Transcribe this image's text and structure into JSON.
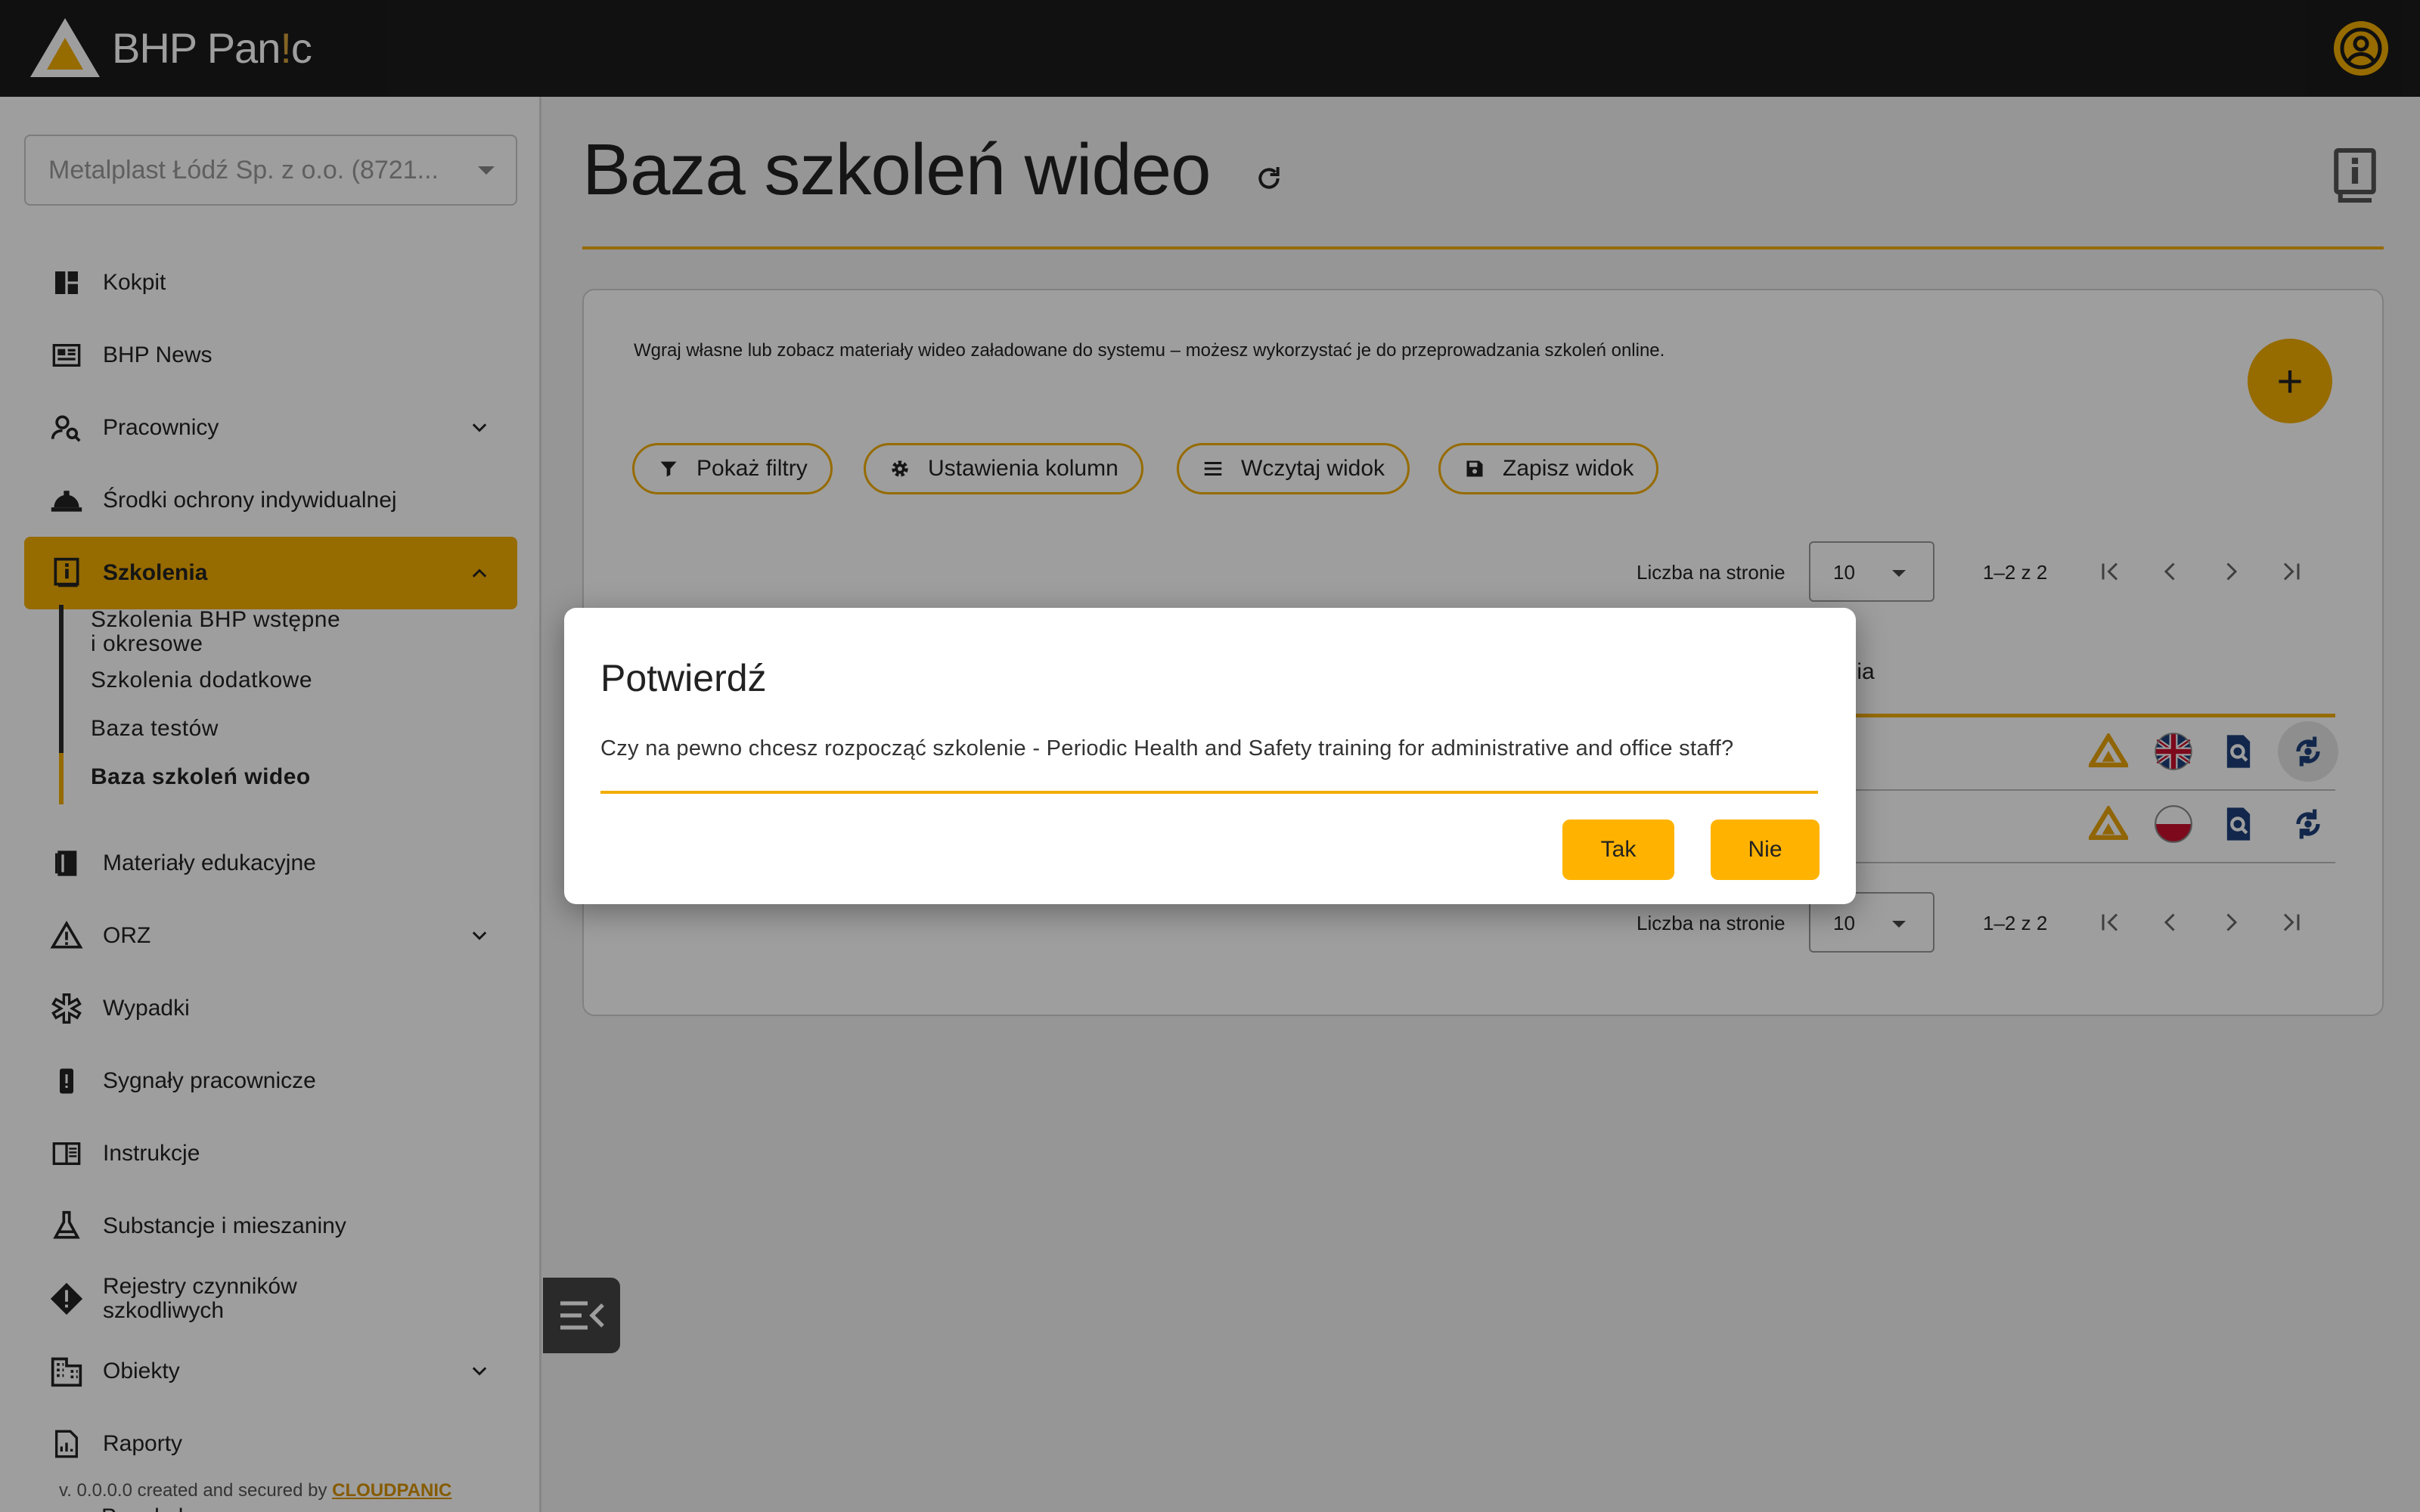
{
  "app": {
    "logo_main": "BHP Pan",
    "logo_accent": "!",
    "logo_end": "c"
  },
  "sidebar": {
    "company": "Metalplast Łódź Sp. z o.o. (8721...",
    "items": [
      {
        "label": "Kokpit",
        "icon": "dashboard-icon"
      },
      {
        "label": "BHP News",
        "icon": "newspaper-icon"
      },
      {
        "label": "Pracownicy",
        "icon": "person-search-icon",
        "expandable": true
      },
      {
        "label": "Środki ochrony indywidualnej",
        "icon": "hard-hat-icon"
      },
      {
        "label": "Szkolenia",
        "icon": "info-book-icon",
        "expanded": true,
        "active": true
      },
      {
        "label": "Materiały edukacyjne",
        "icon": "book-icon"
      },
      {
        "label": "ORZ",
        "icon": "risk-assessment-icon",
        "expandable": true
      },
      {
        "label": "Wypadki",
        "icon": "medical-star-icon"
      },
      {
        "label": "Sygnały pracownicze",
        "icon": "alert-phone-icon"
      },
      {
        "label": "Instrukcje",
        "icon": "open-book-icon"
      },
      {
        "label": "Substancje i mieszaniny",
        "icon": "flask-icon"
      },
      {
        "label": "Rejestry czynników\nszkodliwych",
        "icon": "warning-diamond-icon"
      },
      {
        "label": "Obiekty",
        "icon": "building-icon",
        "expandable": true
      },
      {
        "label": "Raporty",
        "icon": "report-icon"
      }
    ],
    "sub_items": [
      {
        "label": "Szkolenia BHP wstępne\ni okresowe"
      },
      {
        "label": "Szkolenia dodatkowe"
      },
      {
        "label": "Baza testów"
      },
      {
        "label": "Baza szkoleń wideo",
        "active": true
      }
    ],
    "version_prefix": "v. 0.0.0.0 created and secured by ",
    "version_brand": "CLOUDPANIC",
    "cut_item": "Panel ul..."
  },
  "main": {
    "title": "Baza szkoleń wideo",
    "description": "Wgraj własne lub zobacz materiały wideo załadowane do systemu – możesz wykorzystać je do przeprowadzania szkoleń online.",
    "chips": [
      {
        "label": "Pokaż filtry",
        "icon": "filter-icon"
      },
      {
        "label": "Ustawienia kolumn",
        "icon": "gear-icon"
      },
      {
        "label": "Wczytaj widok",
        "icon": "list-icon"
      },
      {
        "label": "Zapisz widok",
        "icon": "save-icon"
      }
    ],
    "pagination": {
      "per_page_label": "Liczba na stronie",
      "per_page_value": "10",
      "range": "1–2 z 2"
    },
    "column_header_fragment": "trwania",
    "rows": [
      {
        "flag": "uk-flag-icon"
      },
      {
        "flag": "pl-flag-icon"
      }
    ]
  },
  "dialog": {
    "title": "Potwierdź",
    "message": "Czy na pewno chcesz rozpocząć szkolenie - Periodic Health and Safety training for administrative and office staff?",
    "yes": "Tak",
    "no": "Nie"
  },
  "colors": {
    "accent": "#f2ad00",
    "topbar": "#1b1b1b",
    "icon_blue": "#1d3f7a"
  }
}
